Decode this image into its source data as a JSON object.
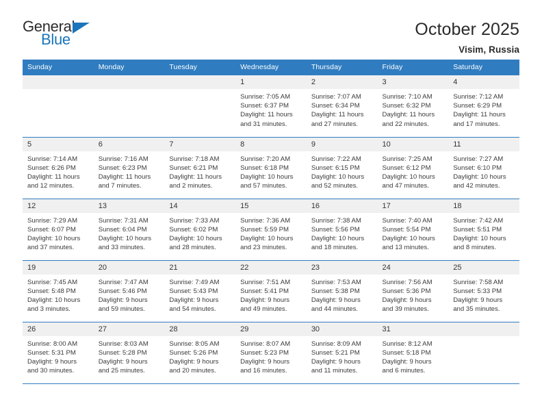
{
  "brand": {
    "name_part1": "General",
    "name_part2": "Blue",
    "triangle_color": "#1b75bb"
  },
  "header": {
    "title": "October 2025",
    "subtitle": "Visim, Russia"
  },
  "colors": {
    "header_blue": "#2f7cc0",
    "daynum_band": "#f0f0f0",
    "text": "#333333"
  },
  "calendar": {
    "weekday_headers": [
      "Sunday",
      "Monday",
      "Tuesday",
      "Wednesday",
      "Thursday",
      "Friday",
      "Saturday"
    ],
    "weeks": [
      [
        {
          "day": "",
          "sunrise": "",
          "sunset": "",
          "daylight_line1": "",
          "daylight_line2": ""
        },
        {
          "day": "",
          "sunrise": "",
          "sunset": "",
          "daylight_line1": "",
          "daylight_line2": ""
        },
        {
          "day": "",
          "sunrise": "",
          "sunset": "",
          "daylight_line1": "",
          "daylight_line2": ""
        },
        {
          "day": "1",
          "sunrise": "Sunrise: 7:05 AM",
          "sunset": "Sunset: 6:37 PM",
          "daylight_line1": "Daylight: 11 hours",
          "daylight_line2": "and 31 minutes."
        },
        {
          "day": "2",
          "sunrise": "Sunrise: 7:07 AM",
          "sunset": "Sunset: 6:34 PM",
          "daylight_line1": "Daylight: 11 hours",
          "daylight_line2": "and 27 minutes."
        },
        {
          "day": "3",
          "sunrise": "Sunrise: 7:10 AM",
          "sunset": "Sunset: 6:32 PM",
          "daylight_line1": "Daylight: 11 hours",
          "daylight_line2": "and 22 minutes."
        },
        {
          "day": "4",
          "sunrise": "Sunrise: 7:12 AM",
          "sunset": "Sunset: 6:29 PM",
          "daylight_line1": "Daylight: 11 hours",
          "daylight_line2": "and 17 minutes."
        }
      ],
      [
        {
          "day": "5",
          "sunrise": "Sunrise: 7:14 AM",
          "sunset": "Sunset: 6:26 PM",
          "daylight_line1": "Daylight: 11 hours",
          "daylight_line2": "and 12 minutes."
        },
        {
          "day": "6",
          "sunrise": "Sunrise: 7:16 AM",
          "sunset": "Sunset: 6:23 PM",
          "daylight_line1": "Daylight: 11 hours",
          "daylight_line2": "and 7 minutes."
        },
        {
          "day": "7",
          "sunrise": "Sunrise: 7:18 AM",
          "sunset": "Sunset: 6:21 PM",
          "daylight_line1": "Daylight: 11 hours",
          "daylight_line2": "and 2 minutes."
        },
        {
          "day": "8",
          "sunrise": "Sunrise: 7:20 AM",
          "sunset": "Sunset: 6:18 PM",
          "daylight_line1": "Daylight: 10 hours",
          "daylight_line2": "and 57 minutes."
        },
        {
          "day": "9",
          "sunrise": "Sunrise: 7:22 AM",
          "sunset": "Sunset: 6:15 PM",
          "daylight_line1": "Daylight: 10 hours",
          "daylight_line2": "and 52 minutes."
        },
        {
          "day": "10",
          "sunrise": "Sunrise: 7:25 AM",
          "sunset": "Sunset: 6:12 PM",
          "daylight_line1": "Daylight: 10 hours",
          "daylight_line2": "and 47 minutes."
        },
        {
          "day": "11",
          "sunrise": "Sunrise: 7:27 AM",
          "sunset": "Sunset: 6:10 PM",
          "daylight_line1": "Daylight: 10 hours",
          "daylight_line2": "and 42 minutes."
        }
      ],
      [
        {
          "day": "12",
          "sunrise": "Sunrise: 7:29 AM",
          "sunset": "Sunset: 6:07 PM",
          "daylight_line1": "Daylight: 10 hours",
          "daylight_line2": "and 37 minutes."
        },
        {
          "day": "13",
          "sunrise": "Sunrise: 7:31 AM",
          "sunset": "Sunset: 6:04 PM",
          "daylight_line1": "Daylight: 10 hours",
          "daylight_line2": "and 33 minutes."
        },
        {
          "day": "14",
          "sunrise": "Sunrise: 7:33 AM",
          "sunset": "Sunset: 6:02 PM",
          "daylight_line1": "Daylight: 10 hours",
          "daylight_line2": "and 28 minutes."
        },
        {
          "day": "15",
          "sunrise": "Sunrise: 7:36 AM",
          "sunset": "Sunset: 5:59 PM",
          "daylight_line1": "Daylight: 10 hours",
          "daylight_line2": "and 23 minutes."
        },
        {
          "day": "16",
          "sunrise": "Sunrise: 7:38 AM",
          "sunset": "Sunset: 5:56 PM",
          "daylight_line1": "Daylight: 10 hours",
          "daylight_line2": "and 18 minutes."
        },
        {
          "day": "17",
          "sunrise": "Sunrise: 7:40 AM",
          "sunset": "Sunset: 5:54 PM",
          "daylight_line1": "Daylight: 10 hours",
          "daylight_line2": "and 13 minutes."
        },
        {
          "day": "18",
          "sunrise": "Sunrise: 7:42 AM",
          "sunset": "Sunset: 5:51 PM",
          "daylight_line1": "Daylight: 10 hours",
          "daylight_line2": "and 8 minutes."
        }
      ],
      [
        {
          "day": "19",
          "sunrise": "Sunrise: 7:45 AM",
          "sunset": "Sunset: 5:48 PM",
          "daylight_line1": "Daylight: 10 hours",
          "daylight_line2": "and 3 minutes."
        },
        {
          "day": "20",
          "sunrise": "Sunrise: 7:47 AM",
          "sunset": "Sunset: 5:46 PM",
          "daylight_line1": "Daylight: 9 hours",
          "daylight_line2": "and 59 minutes."
        },
        {
          "day": "21",
          "sunrise": "Sunrise: 7:49 AM",
          "sunset": "Sunset: 5:43 PM",
          "daylight_line1": "Daylight: 9 hours",
          "daylight_line2": "and 54 minutes."
        },
        {
          "day": "22",
          "sunrise": "Sunrise: 7:51 AM",
          "sunset": "Sunset: 5:41 PM",
          "daylight_line1": "Daylight: 9 hours",
          "daylight_line2": "and 49 minutes."
        },
        {
          "day": "23",
          "sunrise": "Sunrise: 7:53 AM",
          "sunset": "Sunset: 5:38 PM",
          "daylight_line1": "Daylight: 9 hours",
          "daylight_line2": "and 44 minutes."
        },
        {
          "day": "24",
          "sunrise": "Sunrise: 7:56 AM",
          "sunset": "Sunset: 5:36 PM",
          "daylight_line1": "Daylight: 9 hours",
          "daylight_line2": "and 39 minutes."
        },
        {
          "day": "25",
          "sunrise": "Sunrise: 7:58 AM",
          "sunset": "Sunset: 5:33 PM",
          "daylight_line1": "Daylight: 9 hours",
          "daylight_line2": "and 35 minutes."
        }
      ],
      [
        {
          "day": "26",
          "sunrise": "Sunrise: 8:00 AM",
          "sunset": "Sunset: 5:31 PM",
          "daylight_line1": "Daylight: 9 hours",
          "daylight_line2": "and 30 minutes."
        },
        {
          "day": "27",
          "sunrise": "Sunrise: 8:03 AM",
          "sunset": "Sunset: 5:28 PM",
          "daylight_line1": "Daylight: 9 hours",
          "daylight_line2": "and 25 minutes."
        },
        {
          "day": "28",
          "sunrise": "Sunrise: 8:05 AM",
          "sunset": "Sunset: 5:26 PM",
          "daylight_line1": "Daylight: 9 hours",
          "daylight_line2": "and 20 minutes."
        },
        {
          "day": "29",
          "sunrise": "Sunrise: 8:07 AM",
          "sunset": "Sunset: 5:23 PM",
          "daylight_line1": "Daylight: 9 hours",
          "daylight_line2": "and 16 minutes."
        },
        {
          "day": "30",
          "sunrise": "Sunrise: 8:09 AM",
          "sunset": "Sunset: 5:21 PM",
          "daylight_line1": "Daylight: 9 hours",
          "daylight_line2": "and 11 minutes."
        },
        {
          "day": "31",
          "sunrise": "Sunrise: 8:12 AM",
          "sunset": "Sunset: 5:18 PM",
          "daylight_line1": "Daylight: 9 hours",
          "daylight_line2": "and 6 minutes."
        },
        {
          "day": "",
          "sunrise": "",
          "sunset": "",
          "daylight_line1": "",
          "daylight_line2": ""
        }
      ]
    ]
  }
}
